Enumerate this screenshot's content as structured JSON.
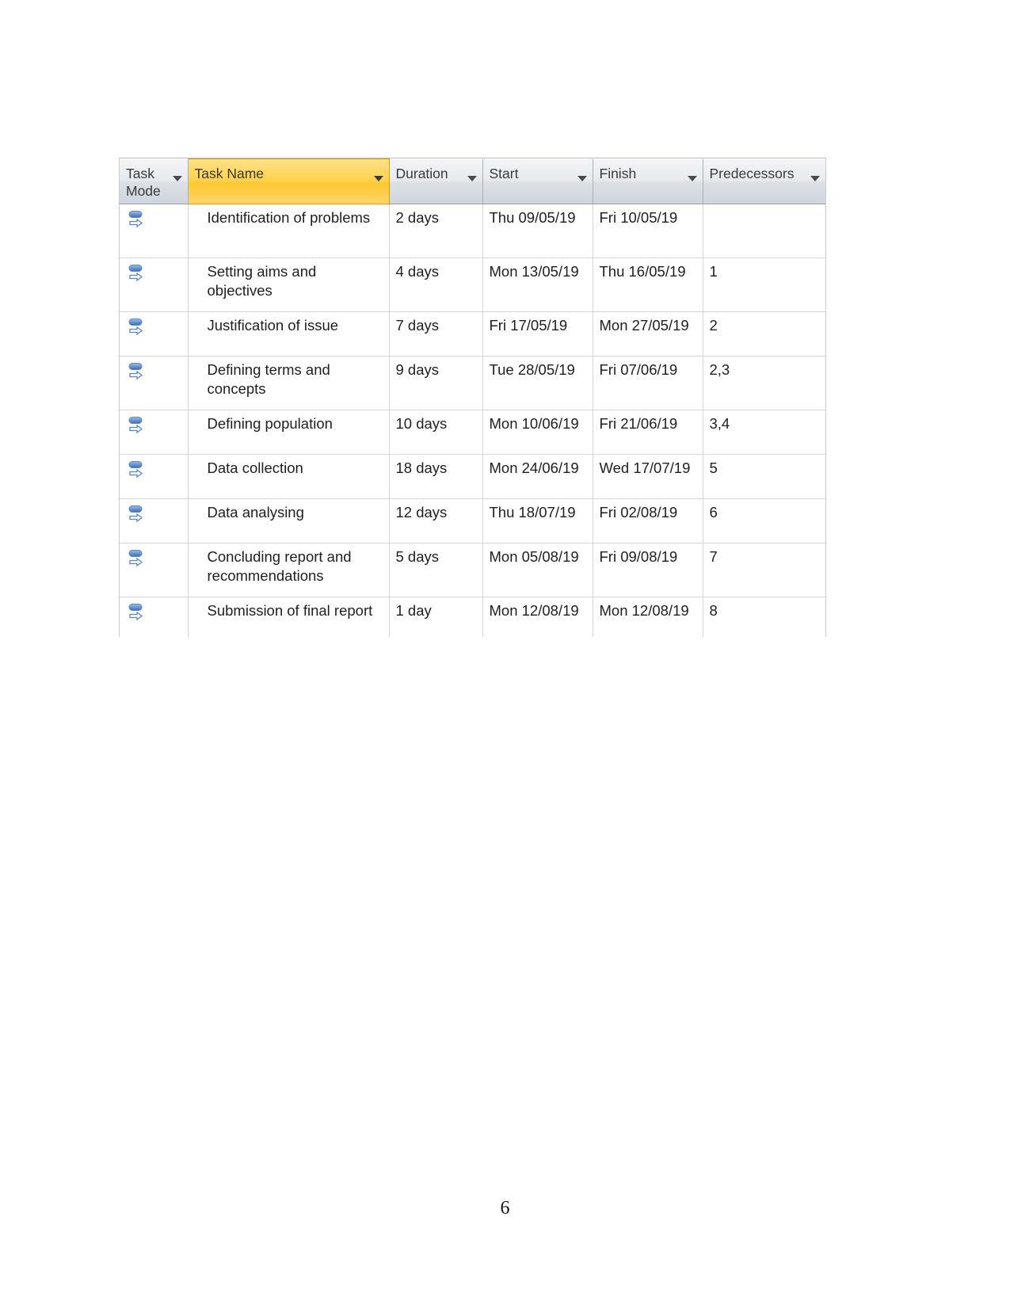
{
  "document": {
    "page_number": "6"
  },
  "table": {
    "columns": [
      {
        "key": "task_mode",
        "label": "Task\nMode",
        "has_filter": true,
        "highlighted": false
      },
      {
        "key": "task_name",
        "label": "Task Name",
        "has_filter": true,
        "highlighted": true
      },
      {
        "key": "duration",
        "label": "Duration",
        "has_filter": true,
        "highlighted": false
      },
      {
        "key": "start",
        "label": "Start",
        "has_filter": true,
        "highlighted": false
      },
      {
        "key": "finish",
        "label": "Finish",
        "has_filter": true,
        "highlighted": false
      },
      {
        "key": "predecessors",
        "label": "Predecessors",
        "has_filter": true,
        "highlighted": false
      }
    ],
    "task_mode_icon": "auto-scheduled-icon",
    "colors": {
      "header_highlight": "#ffd24f",
      "header_highlight_border": "#d99b12",
      "header_default": "#dce1e6",
      "grid_line": "#d3d7db",
      "icon_blue": "#5b87c5",
      "text": "#1f1f1f"
    },
    "rows": [
      {
        "task_mode": "auto-scheduled-icon",
        "task_name": "Identification of problems",
        "duration": "2 days",
        "start": "Thu 09/05/19",
        "finish": "Fri 10/05/19",
        "predecessors": "",
        "height": "tall"
      },
      {
        "task_mode": "auto-scheduled-icon",
        "task_name": "Setting aims and objectives",
        "duration": "4 days",
        "start": "Mon 13/05/19",
        "finish": "Thu 16/05/19",
        "predecessors": "1",
        "height": "tall"
      },
      {
        "task_mode": "auto-scheduled-icon",
        "task_name": "Justification of issue",
        "duration": "7 days",
        "start": "Fri 17/05/19",
        "finish": "Mon 27/05/19",
        "predecessors": "2",
        "height": "short"
      },
      {
        "task_mode": "auto-scheduled-icon",
        "task_name": "Defining terms and concepts",
        "duration": "9 days",
        "start": "Tue 28/05/19",
        "finish": "Fri 07/06/19",
        "predecessors": "2,3",
        "height": "tall"
      },
      {
        "task_mode": "auto-scheduled-icon",
        "task_name": "Defining population",
        "duration": "10 days",
        "start": "Mon 10/06/19",
        "finish": "Fri 21/06/19",
        "predecessors": "3,4",
        "height": "short"
      },
      {
        "task_mode": "auto-scheduled-icon",
        "task_name": "Data collection",
        "duration": "18 days",
        "start": "Mon 24/06/19",
        "finish": "Wed 17/07/19",
        "predecessors": "5",
        "height": "short"
      },
      {
        "task_mode": "auto-scheduled-icon",
        "task_name": "Data analysing",
        "duration": "12 days",
        "start": "Thu 18/07/19",
        "finish": "Fri 02/08/19",
        "predecessors": "6",
        "height": "short"
      },
      {
        "task_mode": "auto-scheduled-icon",
        "task_name": "Concluding report and recommendations",
        "duration": "5 days",
        "start": "Mon 05/08/19",
        "finish": "Fri 09/08/19",
        "predecessors": "7",
        "height": "tall"
      },
      {
        "task_mode": "auto-scheduled-icon",
        "task_name": "Submission of final report",
        "duration": "1 day",
        "start": "Mon 12/08/19",
        "finish": "Mon 12/08/19",
        "predecessors": "8",
        "height": "tall"
      }
    ]
  }
}
